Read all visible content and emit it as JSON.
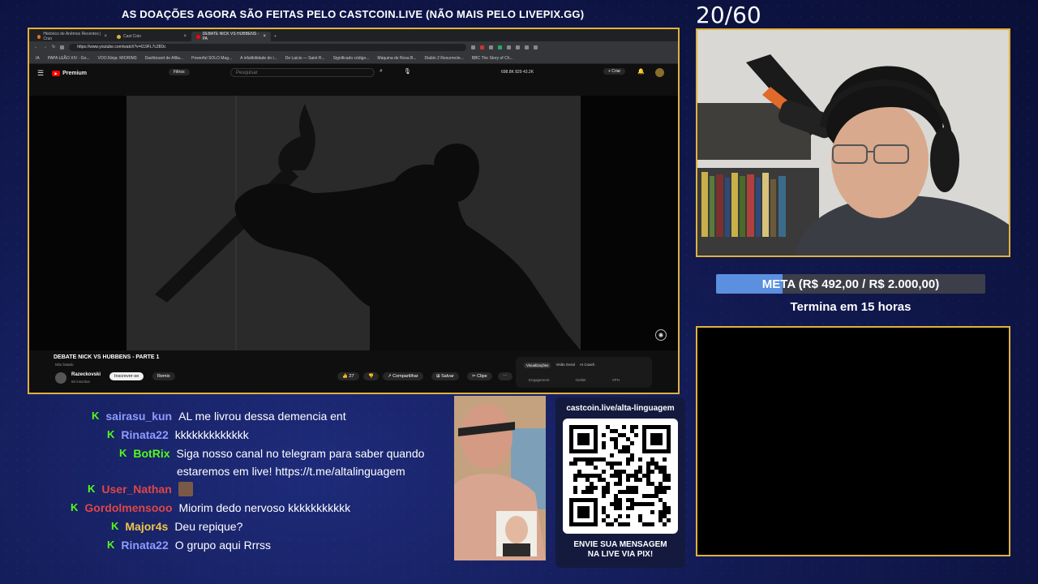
{
  "banner": "AS DOAÇÕES AGORA SÃO FEITAS PELO CASTCOIN.LIVE (NÃO MAIS PELO LIVEPIX.GG)",
  "counter": "20/60",
  "browser": {
    "tabs": [
      {
        "label": "Histórico de Anêmos Recentes | Crun",
        "active": false
      },
      {
        "label": "Cast Coin",
        "active": false
      },
      {
        "label": "DEBATE NICK VS HUBBENS - PA",
        "active": true
      }
    ],
    "url": "https://www.youtube.com/watch?v=619FL7c28Dc",
    "bookmarks": [
      "IA",
      "PAPA LEÃO XIV - Go...",
      "VOO.Ninja: MIORIM3",
      "Dashboard de Afilia...",
      "Powerful SOLO Mag...",
      "A infalibilidade do i...",
      "De Laicis — Saint R...",
      "Significado código...",
      "Máquina de Rosa B...",
      "Diablo 2 Resurrecte...",
      "BBC The Story of Ch..."
    ],
    "youtube": {
      "logo": "Premium",
      "filter_label": "Filtros",
      "search_placeholder": "Pesquisar",
      "stats": "698.8K   829   43.2K",
      "create_label": "+ Criar",
      "video_title": "DEBATE NICK VS HUBBENS - PARTE 1",
      "video_sub": "Não listado",
      "channel_name": "Razeckovski",
      "channel_subs": "92 inscritos",
      "subscribe_label": "Inscrever-se",
      "remix_label": "Remix",
      "likes": "27",
      "share_label": "Compartilhar",
      "save_label": "Salvar",
      "clip_label": "Clipe",
      "side_tabs": [
        "Visualizações",
        "Visão Geral",
        "AI Coach"
      ],
      "side_sub": [
        "Engagement",
        "Outlier",
        "VPH"
      ]
    }
  },
  "meta": {
    "label": "META (R$ 492,00 / R$ 2.000,00)",
    "progress": 0.246,
    "ends_in": "Termina em 15 horas"
  },
  "chat": [
    {
      "user": "sairasu_kun",
      "color": "#8f9bff",
      "text": "AL me livrou dessa demencia ent"
    },
    {
      "user": "Rinata22",
      "color": "#8f9bff",
      "text": "kkkkkkkkkkkkk"
    },
    {
      "user": "BotRix",
      "color": "#53fc18",
      "text": "Siga nosso canal no telegram para saber quando",
      "text2": "estaremos em live! https://t.me/altalinguagem"
    },
    {
      "user": "User_Nathan",
      "color": "#e04646",
      "text": ""
    },
    {
      "user": "Gordolmensooo",
      "color": "#e04646",
      "text": "Miorim dedo nervoso kkkkkkkkkkk"
    },
    {
      "user": "Major4s",
      "color": "#f0c648",
      "text": "Deu repique?"
    },
    {
      "user": "Rinata22",
      "color": "#8f9bff",
      "text": "O grupo aqui Rrrss"
    }
  ],
  "qr": {
    "url": "castcoin.live/alta-linguagem",
    "caption_line1": "ENVIE SUA MENSAGEM",
    "caption_line2": "NA LIVE VIA PIX!"
  }
}
